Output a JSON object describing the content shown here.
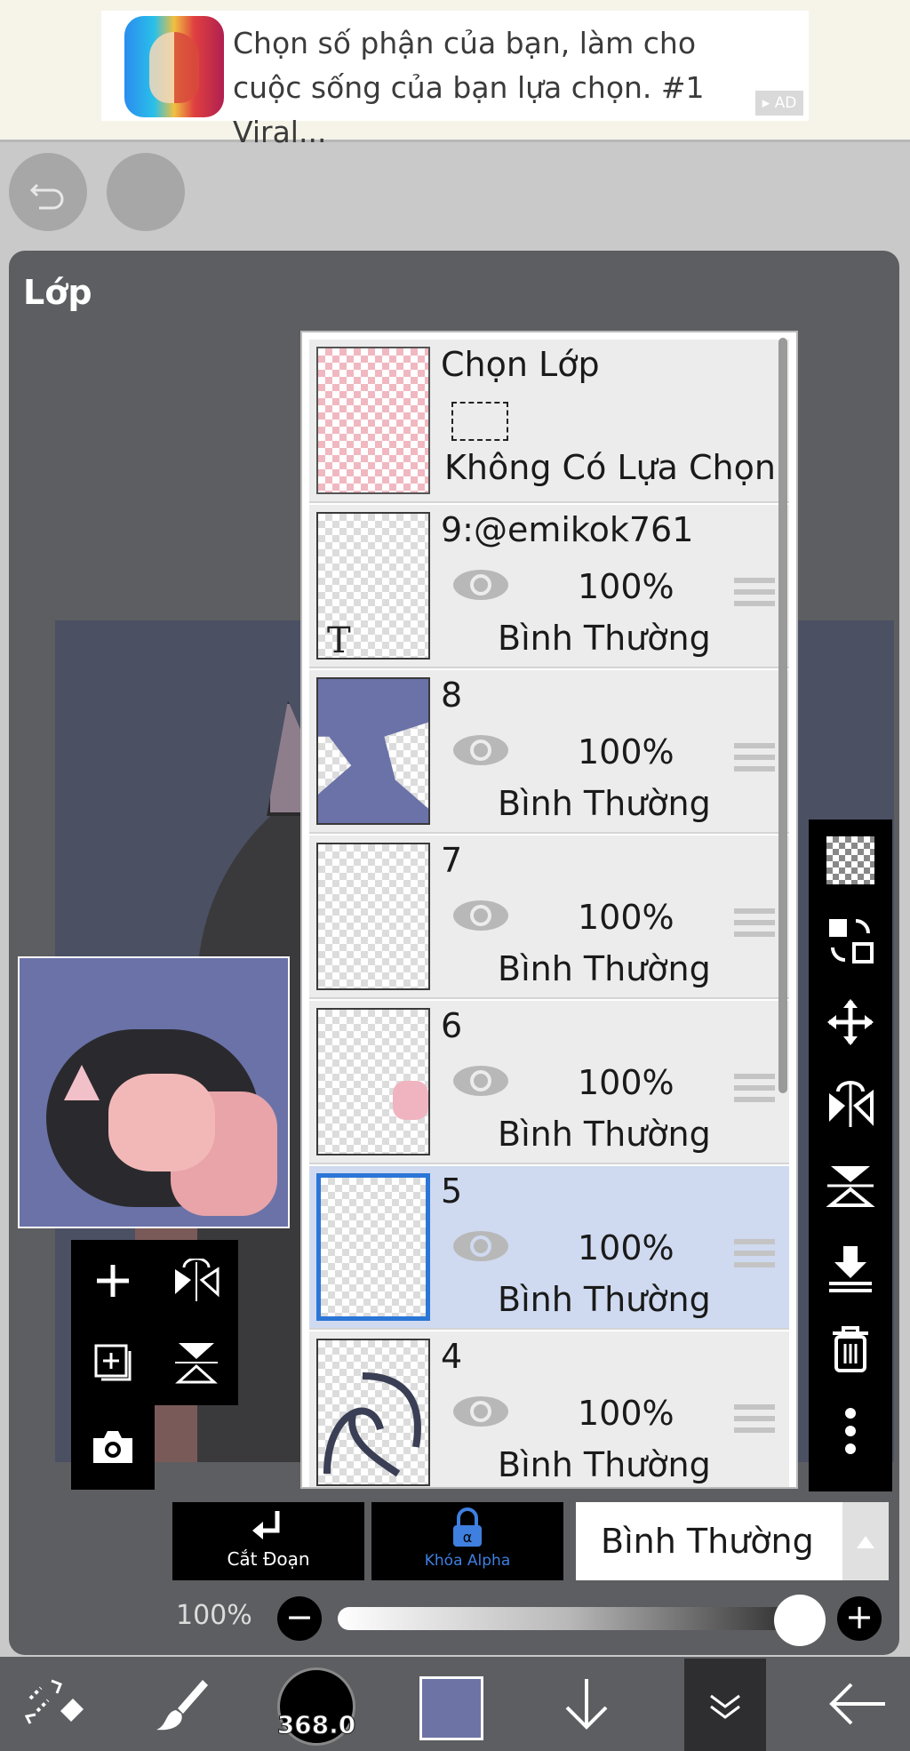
{
  "ad": {
    "text": "Chọn số phận của bạn, làm cho cuộc sống của bạn lựa chọn. #1 Viral...",
    "badge": "▸ AD"
  },
  "panel": {
    "title": "Lớp"
  },
  "selection_row": {
    "name": "Chọn Lớp",
    "status": "Không Có Lựa Chọn"
  },
  "layers": [
    {
      "name": "9:@emikok761",
      "opacity": "100%",
      "blend": "Bình Thường",
      "type": "text"
    },
    {
      "name": "8",
      "opacity": "100%",
      "blend": "Bình Thường"
    },
    {
      "name": "7",
      "opacity": "100%",
      "blend": "Bình Thường"
    },
    {
      "name": "6",
      "opacity": "100%",
      "blend": "Bình Thường"
    },
    {
      "name": "5",
      "opacity": "100%",
      "blend": "Bình Thường",
      "selected": true
    },
    {
      "name": "4",
      "opacity": "100%",
      "blend": "Bình Thường"
    }
  ],
  "controls": {
    "clip_label": "Cắt Đoạn",
    "alpha_lock_label": "Khóa Alpha",
    "blend_mode": "Bình Thường",
    "opacity_label": "100%",
    "opacity_value": 1.0,
    "minus": "−",
    "plus": "+"
  },
  "toolbar": {
    "brush_size": "368.0",
    "color": "#6e73a6"
  },
  "colors": {
    "panel_bg": "#5d5e61",
    "selected_row": "#cfdaf0",
    "accent": "#2b76d6"
  }
}
